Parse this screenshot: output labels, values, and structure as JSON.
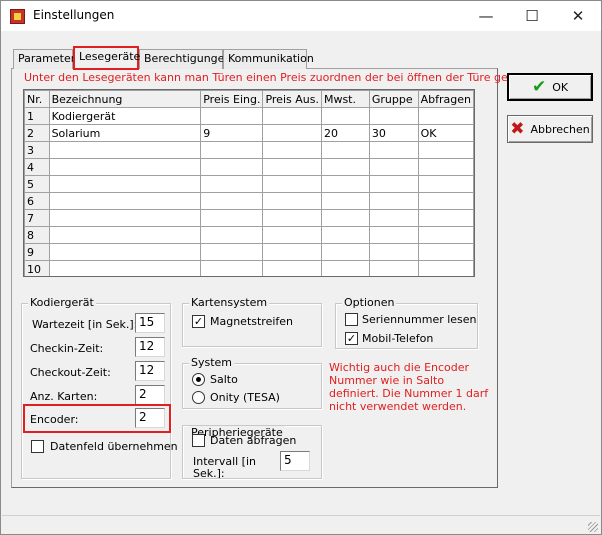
{
  "window": {
    "title": "Einstellungen",
    "minimize_glyph": "—",
    "maximize_glyph": "☐",
    "close_glyph": "✕"
  },
  "tabs": [
    {
      "label": "Parameter",
      "active": false
    },
    {
      "label": "Lesegeräte",
      "active": true
    },
    {
      "label": "Berechtigungen",
      "active": false
    },
    {
      "label": "Kommunikation",
      "active": false
    }
  ],
  "hint_top": "Unter den Lesegeräten kann man Türen einen Preis zuordnen der bei öffnen der Türe geubucht wird",
  "grid": {
    "columns": [
      "Nr.",
      "Bezeichnung",
      "Preis Eing.",
      "Preis Aus.",
      "Mwst.",
      "Gruppe",
      "Abfragen"
    ],
    "rows": [
      [
        "1",
        "Kodiergerät",
        "",
        "",
        "",
        "",
        ""
      ],
      [
        "2",
        "Solarium",
        "9",
        "",
        "20",
        "30",
        "OK"
      ],
      [
        "3",
        "",
        "",
        "",
        "",
        "",
        ""
      ],
      [
        "4",
        "",
        "",
        "",
        "",
        "",
        ""
      ],
      [
        "5",
        "",
        "",
        "",
        "",
        "",
        ""
      ],
      [
        "6",
        "",
        "",
        "",
        "",
        "",
        ""
      ],
      [
        "7",
        "",
        "",
        "",
        "",
        "",
        ""
      ],
      [
        "8",
        "",
        "",
        "",
        "",
        "",
        ""
      ],
      [
        "9",
        "",
        "",
        "",
        "",
        "",
        ""
      ],
      [
        "10",
        "",
        "",
        "",
        "",
        "",
        ""
      ]
    ]
  },
  "kodiergeraet": {
    "title": "Kodiergerät",
    "wartezeit_label": "Wartezeit [in Sek.]:",
    "wartezeit_value": "15",
    "checkin_label": "Checkin-Zeit:",
    "checkin_value": "12",
    "checkout_label": "Checkout-Zeit:",
    "checkout_value": "12",
    "karten_label": "Anz. Karten:",
    "karten_value": "2",
    "encoder_label": "Encoder:",
    "encoder_value": "2",
    "datenfeld_label": "Datenfeld übernehmen",
    "datenfeld_checked": false
  },
  "kartensystem": {
    "title": "Kartensystem",
    "magnet_label": "Magnetstreifen",
    "magnet_checked": true
  },
  "system": {
    "title": "System",
    "salto_label": "Salto",
    "onity_label": "Onity (TESA)",
    "selected": "Salto"
  },
  "peripherie": {
    "title": "Peripheriegeräte",
    "daten_label": "Daten abfragen",
    "daten_checked": false,
    "intervall_label": "Intervall [in Sek.]:",
    "intervall_value": "5"
  },
  "optionen": {
    "title": "Optionen",
    "serien_label": "Seriennummer lesen",
    "serien_checked": false,
    "mobil_label": "Mobil-Telefon",
    "mobil_checked": true
  },
  "hint_encoder": "Wichtig auch die Encoder Nummer wie in Salto definiert. Die Nummer  1 darf nicht verwendet werden.",
  "buttons": {
    "ok_label": "OK",
    "ok_icon": "✔",
    "cancel_label": "Abbrechen",
    "cancel_icon": "✖"
  },
  "colors": {
    "highlight_red": "#e02020",
    "ok_green": "#1a9a1a",
    "cancel_red": "#c01818"
  }
}
